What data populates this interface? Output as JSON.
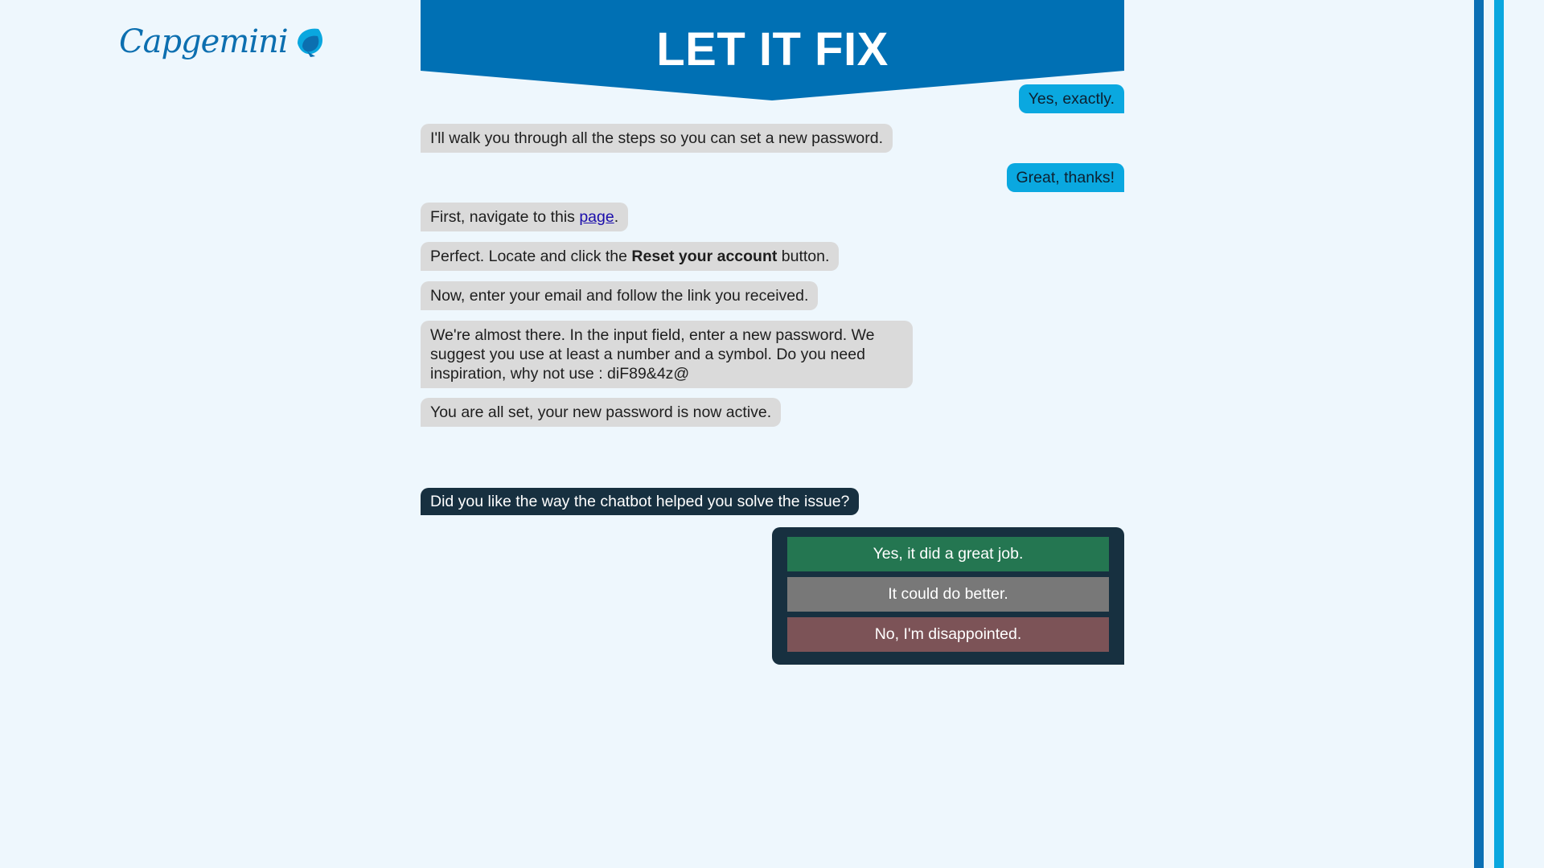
{
  "brand": {
    "name": "Capgemini",
    "color": "#0c6fb0"
  },
  "banner": {
    "title": "LET IT FIX",
    "color": "#0070b4"
  },
  "chat": {
    "messages": [
      {
        "role": "user",
        "text": "Yes, exactly."
      },
      {
        "role": "bot",
        "text": "I'll walk you through all the steps so you can set a new password."
      },
      {
        "role": "user",
        "text": "Great, thanks!"
      },
      {
        "role": "bot",
        "prefix": "First, navigate to this ",
        "link": "page",
        "suffix": "."
      },
      {
        "role": "bot",
        "prefix": "Perfect. Locate and click the ",
        "bold": "Reset your account",
        "suffix": " button."
      },
      {
        "role": "bot",
        "text": "Now, enter your email and follow the link you received."
      },
      {
        "role": "bot",
        "text": "We're almost there. In the input field, enter a new password. We suggest you use at least a number and a symbol. Do you need inspiration, why not use : diF89&4z@"
      },
      {
        "role": "bot",
        "text": "You are all set, your new password is now active."
      }
    ]
  },
  "feedback": {
    "question": "Did you like the way the chatbot helped you solve the issue?",
    "options": {
      "good": "Yes, it did a great job.",
      "mid": "It could do better.",
      "bad": "No, I'm disappointed."
    },
    "colors": {
      "good": "#247651",
      "mid": "#787878",
      "bad": "#7c5357"
    }
  },
  "icons": {
    "brand_mark": "spade-icon"
  }
}
